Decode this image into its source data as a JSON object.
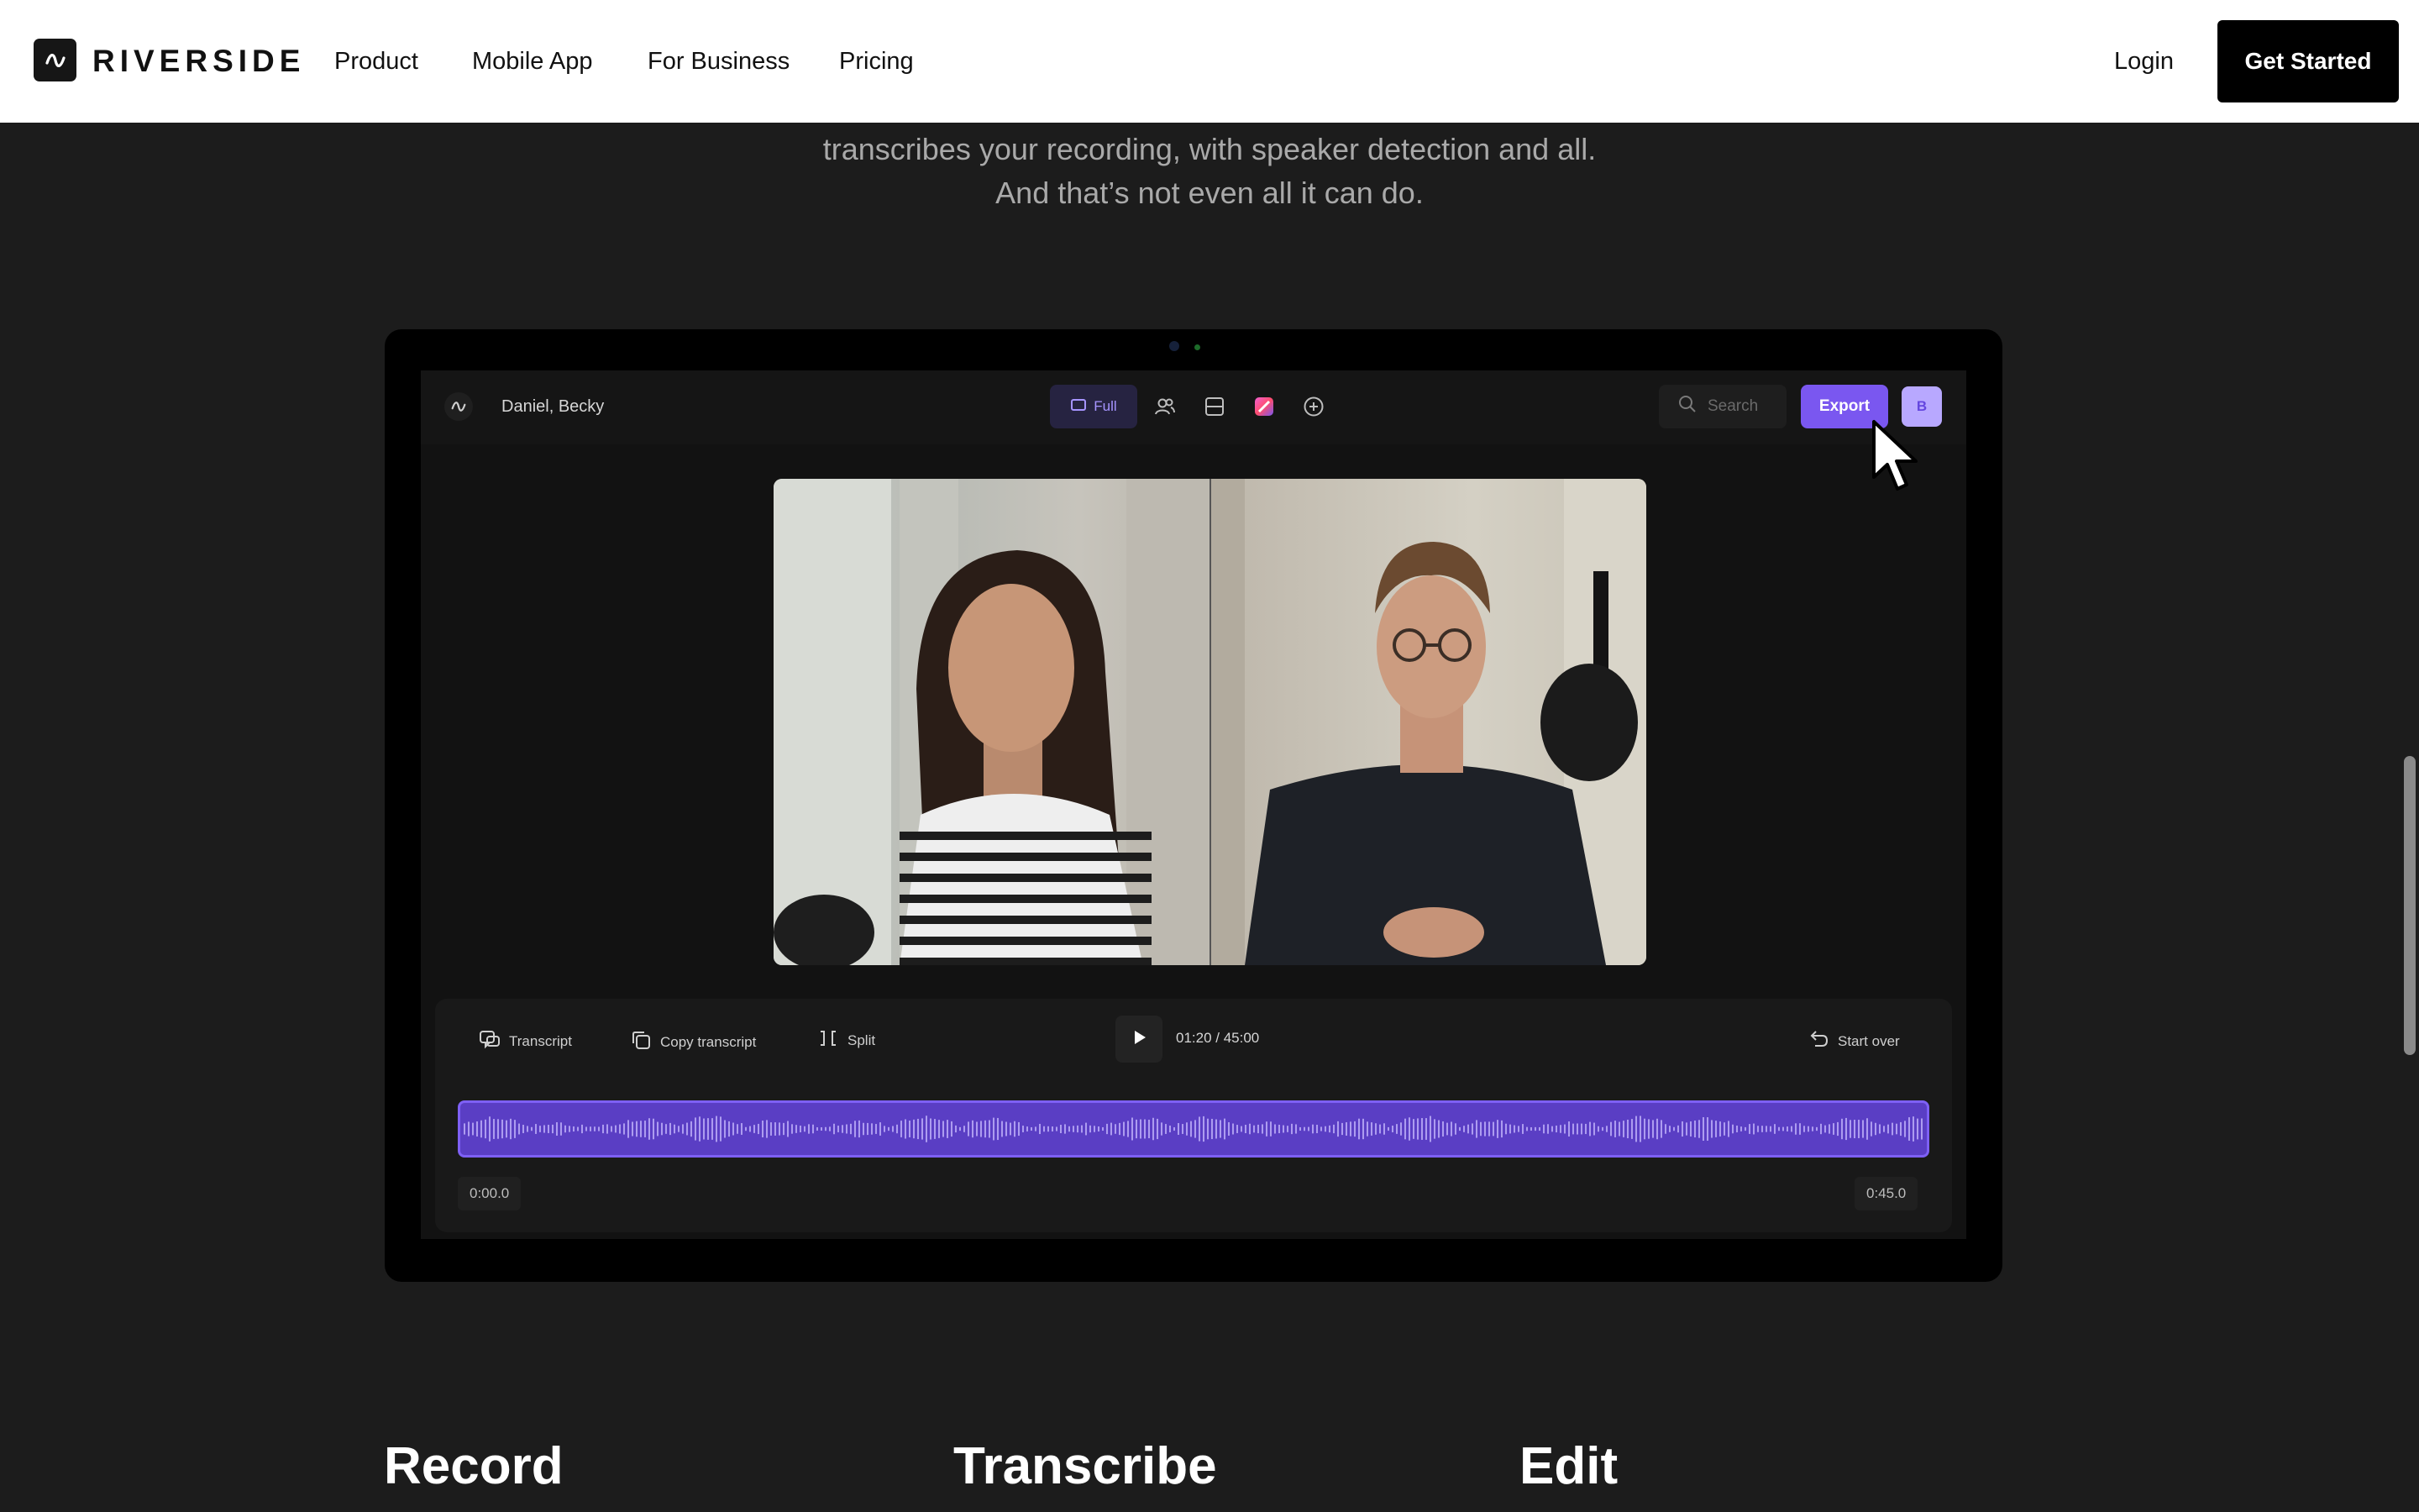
{
  "nav": {
    "brand": "RIVERSIDE",
    "links": [
      "Product",
      "Mobile App",
      "For Business",
      "Pricing"
    ],
    "login": "Login",
    "cta": "Get Started"
  },
  "intro": {
    "line1": "transcribes your recording, with speaker detection and all.",
    "line2": "And that’s not even all it can do."
  },
  "app": {
    "title": "Daniel, Becky",
    "view_full": "Full",
    "search_placeholder": "Search",
    "export": "Export",
    "avatar": "B",
    "controls": {
      "transcript": "Transcript",
      "copy_transcript": "Copy transcript",
      "split": "Split",
      "timer": "01:20 / 45:00",
      "start_over": "Start over"
    },
    "timeline": {
      "start": "0:00.0",
      "end": "0:45.0"
    }
  },
  "features": [
    "Record",
    "Transcribe",
    "Edit"
  ],
  "colors": {
    "accent": "#7a57f0",
    "page_bg": "#1c1c1c",
    "nav_bg": "#ffffff"
  },
  "icons": [
    "riverside-logo-icon",
    "full-view-icon",
    "speakers-icon",
    "layout-icon",
    "gradient-color-icon",
    "add-circle-icon",
    "search-icon",
    "transcript-icon",
    "copy-icon",
    "split-icon",
    "play-icon",
    "undo-icon",
    "cursor-icon"
  ]
}
